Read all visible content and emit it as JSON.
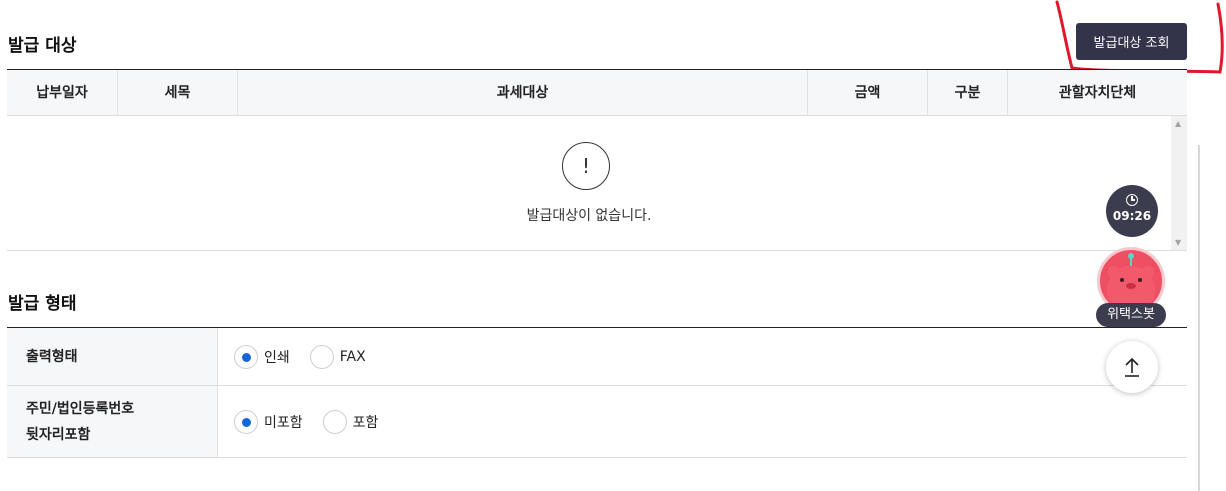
{
  "section_issue_target": {
    "title": "발급 대상",
    "lookup_button": "발급대상 조회"
  },
  "table": {
    "columns": [
      "납부일자",
      "세목",
      "과세대상",
      "금액",
      "구분",
      "관할자치단체"
    ],
    "empty_icon": "!",
    "empty_message": "발급대상이 없습니다."
  },
  "section_issue_type": {
    "title": "발급 형태",
    "rows": [
      {
        "label": "출력형태",
        "options": [
          {
            "label": "인쇄",
            "checked": true
          },
          {
            "label": "FAX",
            "checked": false
          }
        ]
      },
      {
        "label_line1": "주민/법인등록번호",
        "label_line2": "뒷자리포함",
        "options": [
          {
            "label": "미포함",
            "checked": true
          },
          {
            "label": "포함",
            "checked": false
          }
        ]
      }
    ]
  },
  "widgets": {
    "timer": "09:26",
    "chatbot_label": "위택스봇",
    "top_icon": "arrow-up-icon"
  },
  "colors": {
    "primary_button": "#33334a",
    "radio_checked": "#1565d8",
    "annotation": "#e0182a",
    "chatbot": "#ef4f63"
  }
}
